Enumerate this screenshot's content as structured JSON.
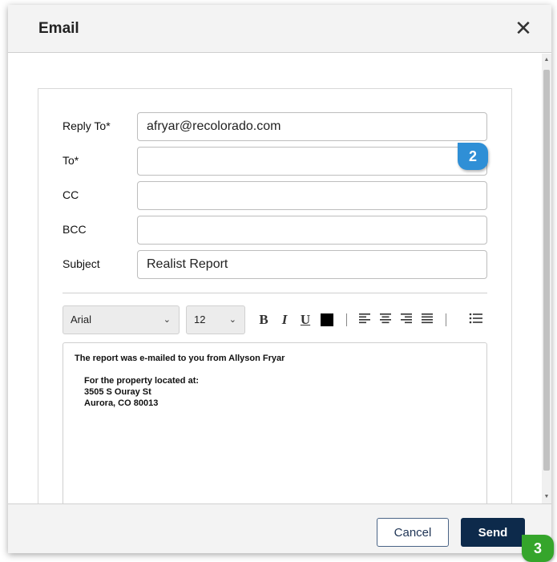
{
  "dialog": {
    "title": "Email",
    "close_glyph": "✕"
  },
  "form": {
    "reply_to": {
      "label": "Reply To*",
      "value": "afryar@recolorado.com"
    },
    "to": {
      "label": "To*",
      "value": ""
    },
    "cc": {
      "label": "CC",
      "value": ""
    },
    "bcc": {
      "label": "BCC",
      "value": ""
    },
    "subject": {
      "label": "Subject",
      "value": "Realist Report"
    }
  },
  "toolbar": {
    "font_family": "Arial",
    "font_size": "12",
    "bold": "B",
    "italic": "I",
    "underline": "U",
    "text_color": "#000000",
    "icons": [
      "bold-icon",
      "italic-icon",
      "underline-icon",
      "text-color-icon",
      "align-left-icon",
      "align-center-icon",
      "align-right-icon",
      "justify-icon",
      "bullet-list-icon"
    ]
  },
  "editor": {
    "line1": "The report was e-mailed to you from Allyson Fryar",
    "line2": "For the property located at:",
    "line3": "3505 S Ouray St",
    "line4": "Aurora, CO 80013"
  },
  "footer": {
    "cancel_label": "Cancel",
    "send_label": "Send"
  },
  "badges": {
    "to_step": "2",
    "send_step": "3"
  },
  "colors": {
    "send_button": "#0d2a4b",
    "badge_blue": "#2f8fd6",
    "badge_green": "#35a52b"
  }
}
